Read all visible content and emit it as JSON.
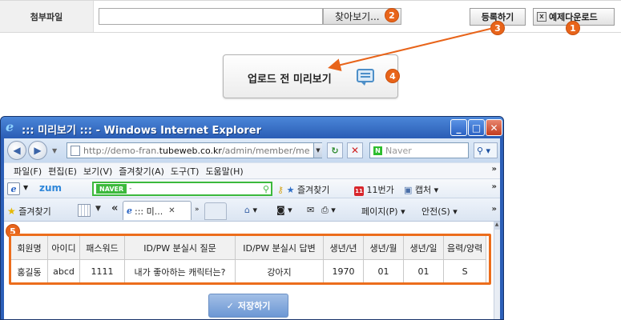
{
  "form": {
    "attach_label": "첨부파일",
    "browse_label": "찾아보기...",
    "register_label": "등록하기",
    "download_label": "예제다운로드",
    "excel_icon_text": "X"
  },
  "preview_button": {
    "label": "업로드 전 미리보기"
  },
  "badges": {
    "b1": "1",
    "b2": "2",
    "b3": "3",
    "b4": "4",
    "b5": "5"
  },
  "ie": {
    "title": "::: 미리보기 ::: - Windows Internet Explorer",
    "address_prefix": "http://demo-fran.",
    "address_domain": "tubeweb.co.kr",
    "address_suffix": "/admin/member/me",
    "search_placeholder": "Naver",
    "menu": [
      "파일(F)",
      "편집(E)",
      "보기(V)",
      "즐겨찾기(A)",
      "도구(T)",
      "도움말(H)"
    ],
    "zum_label": "zum",
    "naver_tag": "NAVER",
    "naver_dash": "-",
    "toolbar1": {
      "favorites": "즐겨찾기",
      "st11": "11번가",
      "capture": "캡처"
    },
    "favorites_label": "즐겨찾기",
    "tab_title": "::: 미...",
    "commands": {
      "page": "페이지(P)",
      "safety": "안전(S)"
    }
  },
  "table": {
    "headers": [
      "회원명",
      "아이디",
      "패스워드",
      "ID/PW 분실시 질문",
      "ID/PW 분실시 답변",
      "생년/년",
      "생년/월",
      "생년/일",
      "음력/양력"
    ],
    "row": [
      "홍길동",
      "abcd",
      "1111",
      "내가 좋아하는 캐릭터는?",
      "강아지",
      "1970",
      "01",
      "01",
      "S"
    ]
  },
  "save_button": {
    "label": "저장하기"
  },
  "colors": {
    "accent_orange": "#e8641a",
    "ie_blue": "#2c5fb8"
  }
}
